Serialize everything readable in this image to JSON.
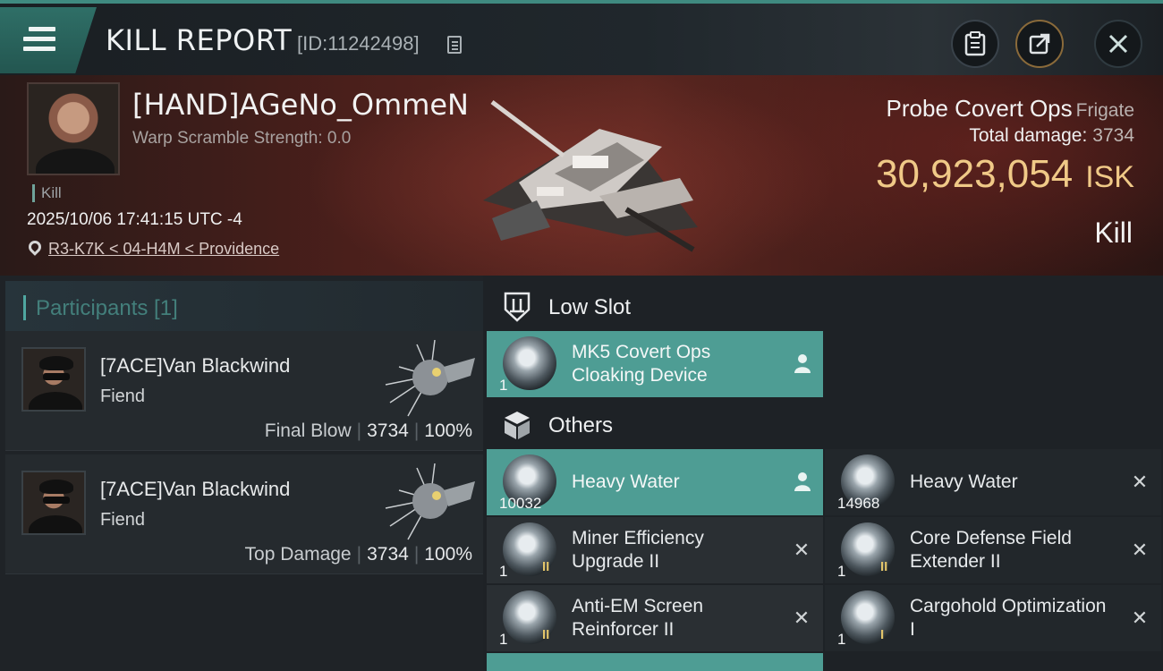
{
  "header": {
    "title": "KILL REPORT",
    "report_id": "[ID:11242498]",
    "icons": [
      "menu-icon",
      "copy-icon",
      "clipboard-icon",
      "share-icon",
      "close-icon"
    ]
  },
  "victim": {
    "name": "[HAND]AGeNo_OmmeN",
    "warp_scramble": "Warp Scramble Strength: 0.0",
    "tag": "Kill",
    "timestamp": "2025/10/06 17:41:15 UTC -4",
    "location": "R3-K7K < 04-H4M < Providence",
    "ship_name": "Probe Covert Ops",
    "ship_class": "Frigate",
    "total_damage_label": "Total damage:",
    "total_damage": "3734",
    "isk_value": "30,923,054",
    "isk_unit": "ISK",
    "result": "Kill"
  },
  "participants": {
    "title": "Participants [1]",
    "items": [
      {
        "name": "[7ACE]Van Blackwind",
        "ship": "Fiend",
        "role": "Final Blow",
        "damage": "3734",
        "percent": "100%"
      },
      {
        "name": "[7ACE]Van Blackwind",
        "ship": "Fiend",
        "role": "Top Damage",
        "damage": "3734",
        "percent": "100%"
      }
    ]
  },
  "modules": {
    "low_slot": {
      "label": "Low Slot",
      "items": [
        {
          "name": "MK5 Covert Ops Cloaking Device",
          "qty": "1",
          "status": "dropped"
        }
      ]
    },
    "others": {
      "label": "Others",
      "items": [
        {
          "name": "Heavy Water",
          "qty": "10032",
          "status": "dropped"
        },
        {
          "name": "Heavy Water",
          "qty": "14968",
          "status": "destroyed"
        },
        {
          "name": "Miner Efficiency Upgrade II",
          "qty": "1",
          "tier": "II",
          "status": "destroyed"
        },
        {
          "name": "Core Defense Field Extender II",
          "qty": "1",
          "tier": "II",
          "status": "destroyed"
        },
        {
          "name": "Anti-EM Screen Reinforcer II",
          "qty": "1",
          "tier": "II",
          "status": "destroyed"
        },
        {
          "name": "Cargohold Optimization I",
          "qty": "1",
          "tier": "I",
          "status": "destroyed"
        }
      ]
    }
  },
  "colors": {
    "accent_teal": "#4e9d94",
    "isk_gold": "#f0c987",
    "banner_red": "#5a2620"
  }
}
